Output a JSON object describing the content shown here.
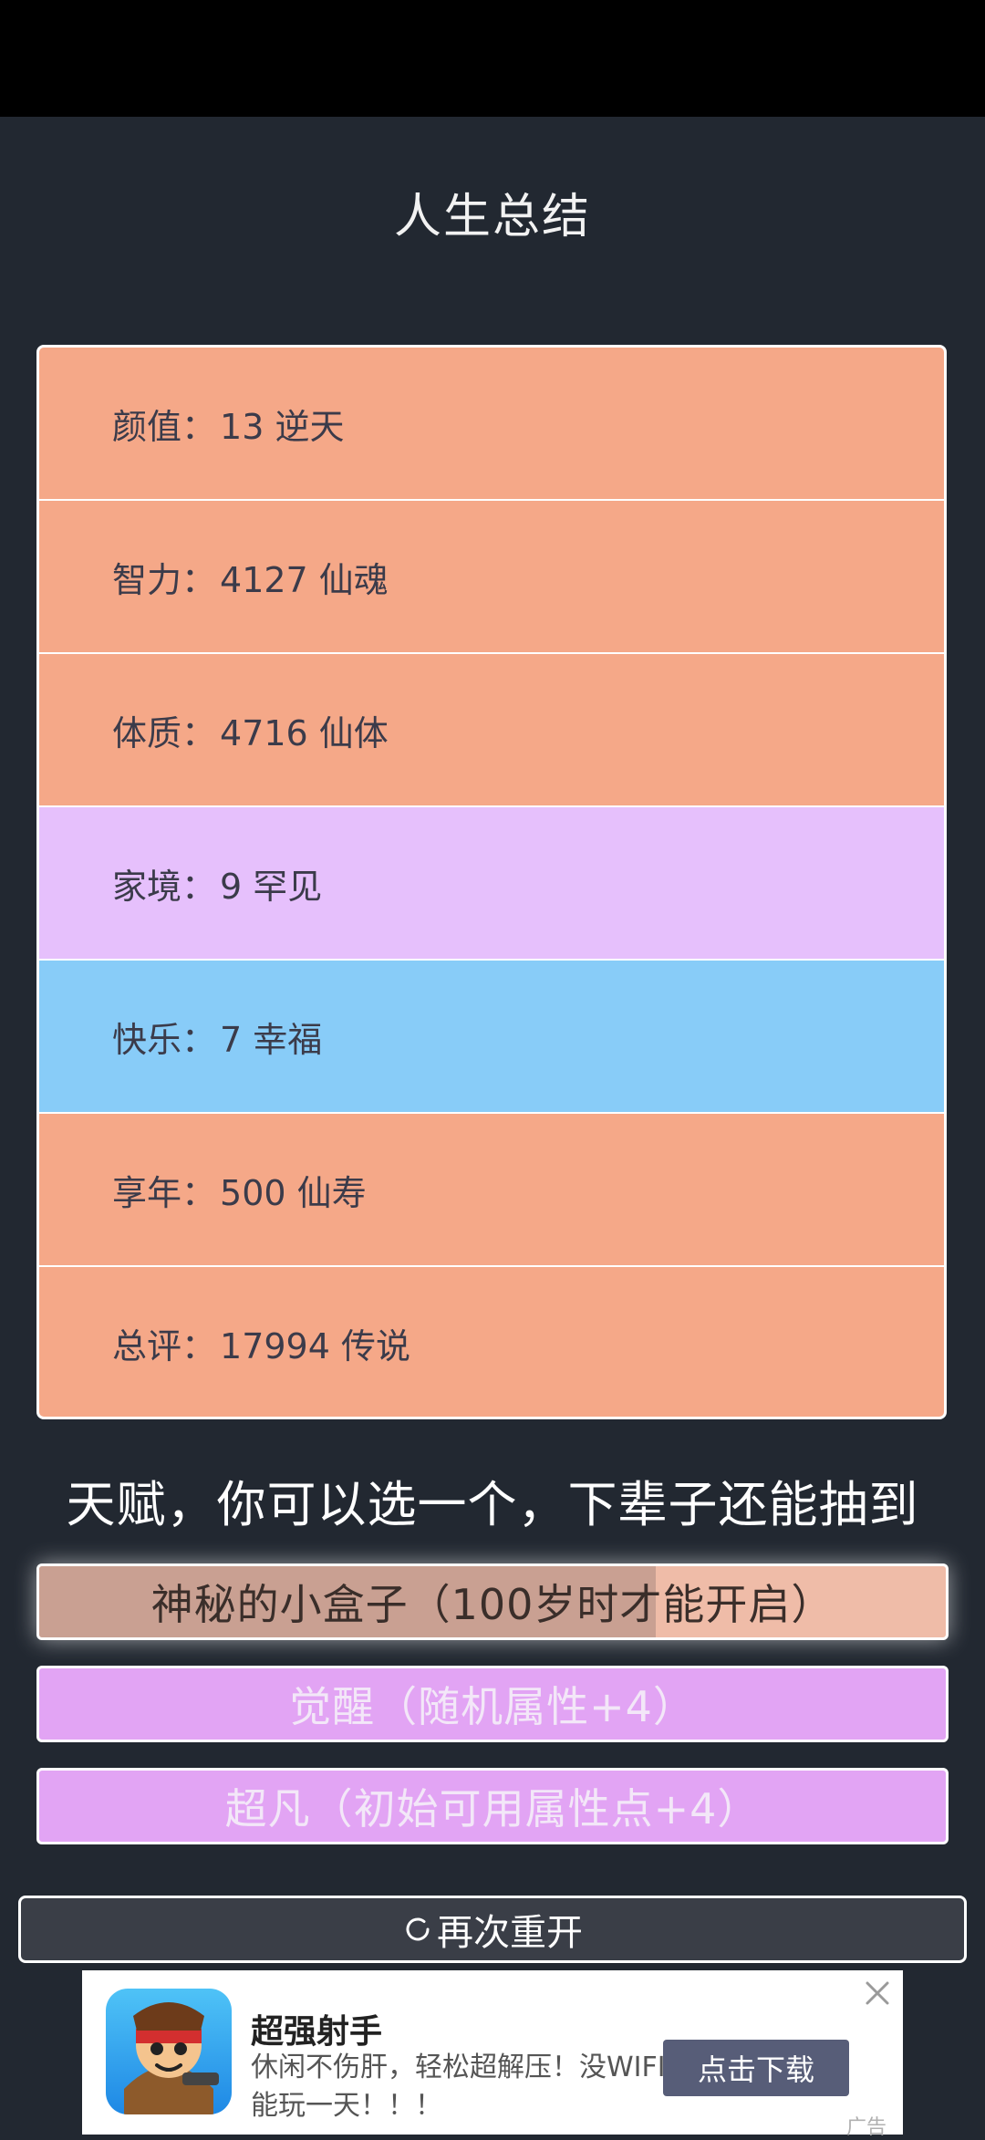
{
  "header": {
    "title": "人生总结"
  },
  "stats": [
    {
      "label": "颜值：",
      "value": "13 逆天",
      "color": "#f5a888"
    },
    {
      "label": "智力：",
      "value": "4127 仙魂",
      "color": "#f5a888"
    },
    {
      "label": "体质：",
      "value": "4716 仙体",
      "color": "#f5a888"
    },
    {
      "label": "家境：",
      "value": "9 罕见",
      "color": "#e6c0fc"
    },
    {
      "label": "快乐：",
      "value": "7 幸福",
      "color": "#88ccf8"
    },
    {
      "label": "享年：",
      "value": "500 仙寿",
      "color": "#f5a888"
    },
    {
      "label": "总评：",
      "value": "17994 传说",
      "color": "#f5a888"
    }
  ],
  "talents": {
    "heading": "天赋，你可以选一个，下辈子还能抽到",
    "options": [
      {
        "label": "神秘的小盒子（100岁时才能开启）",
        "color": "#efbca8"
      },
      {
        "label": "觉醒（随机属性+4）",
        "color": "#e2a4f4"
      },
      {
        "label": "超凡（初始可用属性点+4）",
        "color": "#e2a4f4"
      }
    ]
  },
  "restart": {
    "label": "再次重开",
    "icon": "refresh-icon"
  },
  "ad": {
    "title": "超强射手",
    "description": "休闲不伤肝，轻松超解压！没WIFI我也能玩一天！！！",
    "cta": "点击下载",
    "tag": "广告",
    "icon": "game-character-icon",
    "close_icon": "close-icon"
  }
}
